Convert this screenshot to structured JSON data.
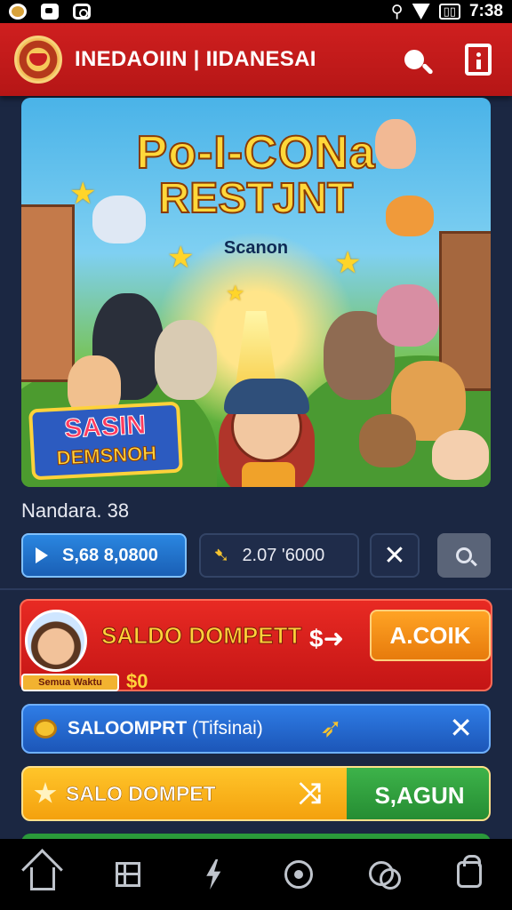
{
  "status_bar": {
    "time": "7:38",
    "icons": [
      "app-icon",
      "message-icon",
      "camera-icon",
      "vibrate-icon",
      "wifi-icon",
      "battery-icon"
    ]
  },
  "header": {
    "brand": "INEDAOIIN | IIDANESAI",
    "logo_icon": "emblem-logo",
    "actions": [
      "search-icon",
      "info-icon"
    ],
    "background_color": "#c61b1b"
  },
  "banner": {
    "title_line1": "Po-I-CONa",
    "title_line2": "RESTJNT",
    "subtitle": "Scanon",
    "badge_line1": "SASIN",
    "badge_line2": "DEMSNOH"
  },
  "info": {
    "username": "Nandara. 38",
    "play_value": "S,68 8,0800",
    "coin_value": "2.07 '6000"
  },
  "wallet": {
    "title": "SALDO DOMPETT",
    "amount": "$0",
    "avatar_tag": "Semua Waktu",
    "action_label": "A.COIK",
    "accent_color": "#e82a23"
  },
  "blue_row": {
    "label": "SALOOMPRT",
    "label_suffix": "(Tifsinai)"
  },
  "yellow_row": {
    "label": "SALO DOMPET",
    "action_label": "S,AGUN"
  },
  "bottom_nav": [
    "home-icon",
    "grid-icon",
    "bolt-icon",
    "target-icon",
    "chat-icon",
    "bag-icon"
  ]
}
